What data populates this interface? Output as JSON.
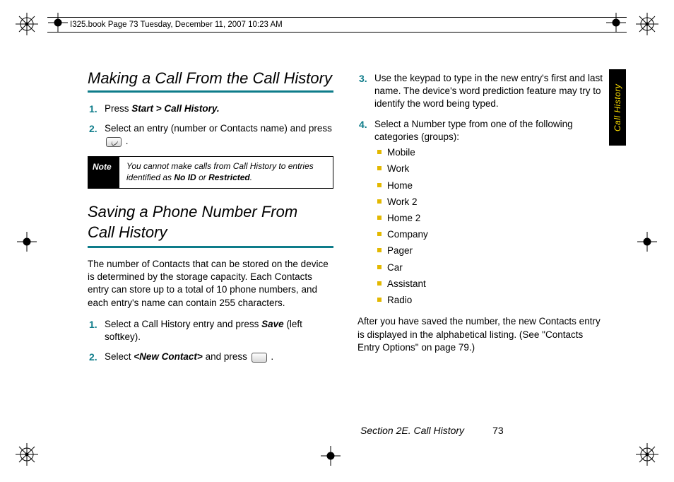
{
  "doc_header": "I325.book  Page 73  Tuesday, December 11, 2007  10:23 AM",
  "side_tab": "Call History",
  "left": {
    "heading1": "Making a Call From the Call History",
    "step1_pre": "Press ",
    "step1_bi": "Start > Call History.",
    "step2": "Select an entry (number or Contacts name) and press ",
    "note_label": "Note",
    "note_body_pre": "You cannot make calls from Call History to entries identified as ",
    "note_body_b1": "No ID",
    "note_body_mid": " or ",
    "note_body_b2": "Restricted",
    "note_body_post": ".",
    "heading2a": "Saving a Phone Number From",
    "heading2b": "Call History",
    "intro": "The number of Contacts that can be stored on the device is determined by the storage capacity. Each Contacts entry can store up to a total of 10 phone numbers, and each entry's name can contain 255 characters.",
    "s1_pre": "Select a Call History entry and press ",
    "s1_bi": "Save",
    "s1_post": " (left softkey).",
    "s2_pre": "Select ",
    "s2_bi": "<New Contact>",
    "s2_post": " and press "
  },
  "right": {
    "step3": "Use the keypad to type in the new entry's first and last name. The device's word prediction feature may try to identify the word being typed.",
    "step4": "Select a Number type from one of the following categories (groups):",
    "bullets": [
      "Mobile",
      "Work",
      "Home",
      "Work 2",
      "Home 2",
      "Company",
      "Pager",
      "Car",
      "Assistant",
      "Radio"
    ],
    "outro": "After you have saved the number, the new Contacts entry is displayed in the alphabetical listing. (See \"Contacts Entry Options\" on page 79.)"
  },
  "footer": {
    "section": "Section 2E. Call History",
    "page": "73"
  }
}
